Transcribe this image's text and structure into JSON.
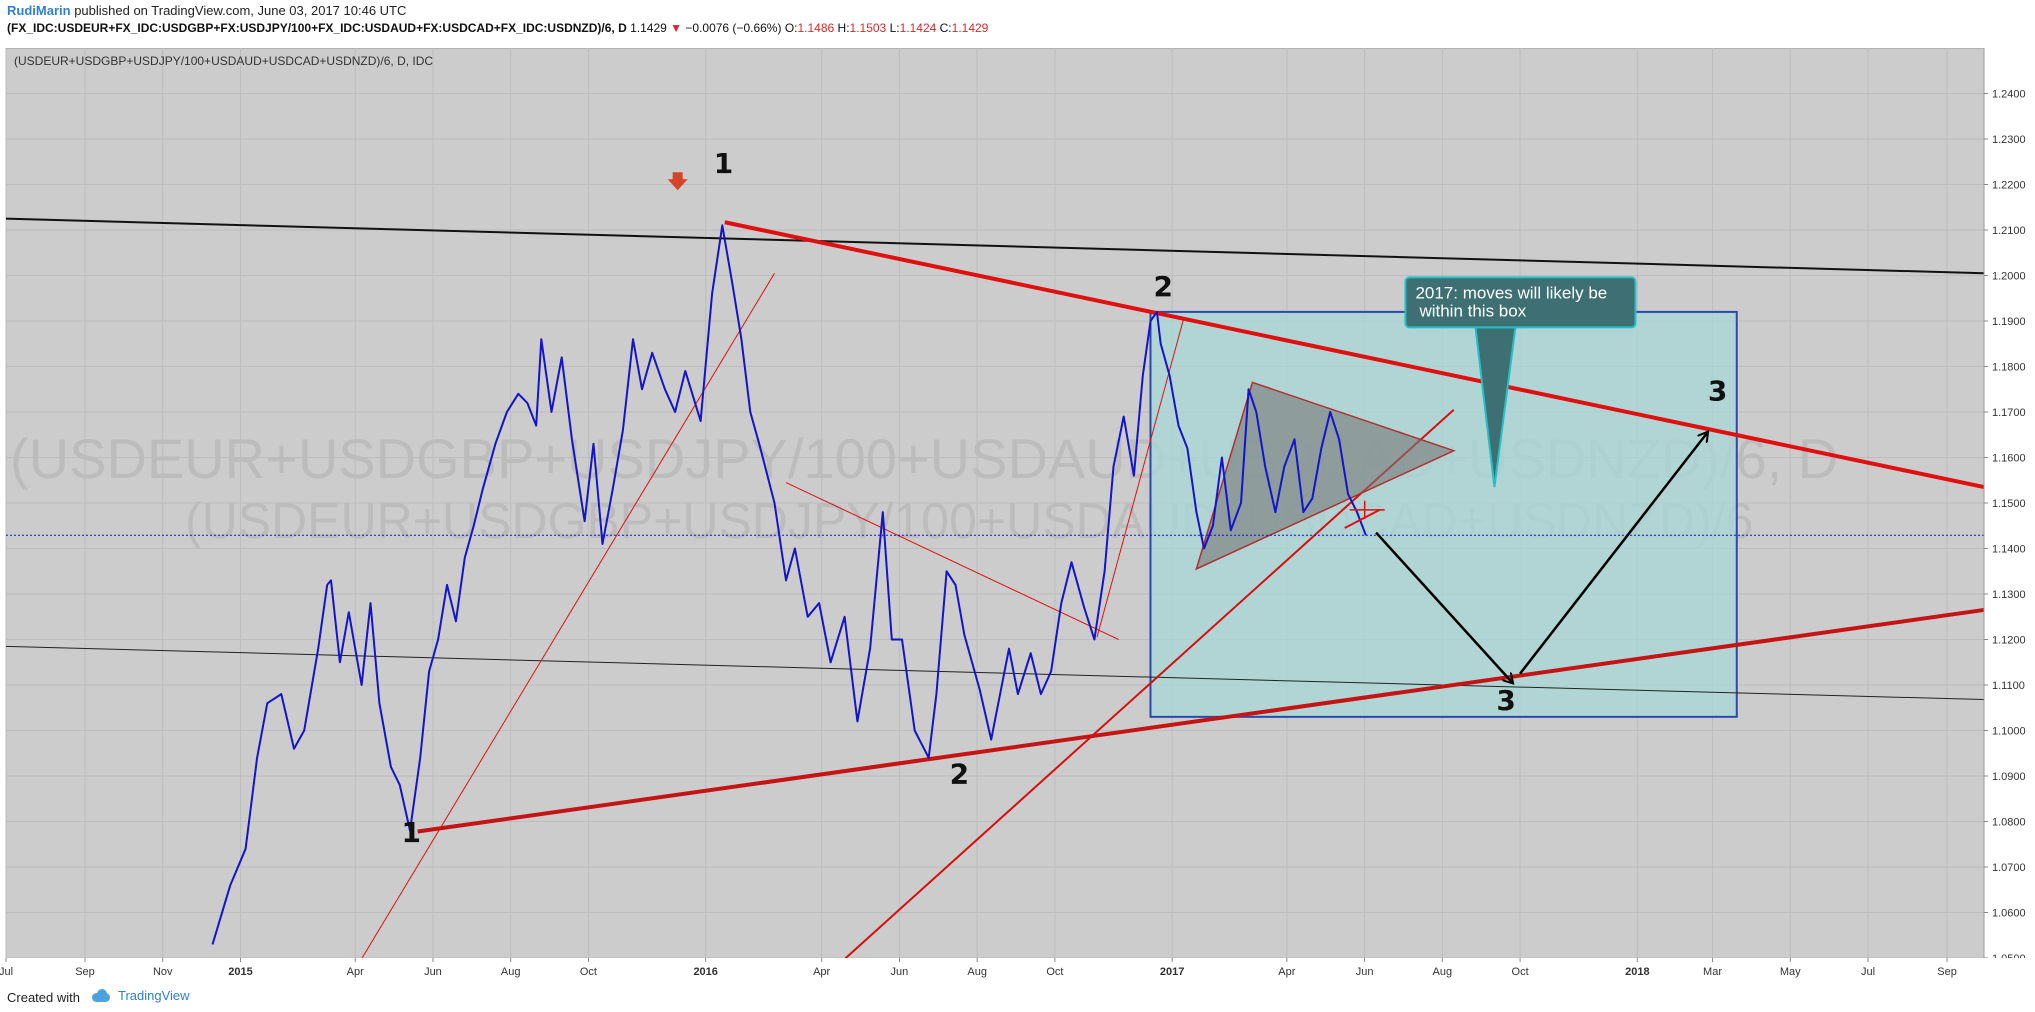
{
  "header": {
    "author": "RudiMarin",
    "published": "published on TradingView.com, June 03, 2017 10:46 UTC",
    "symbol": "(FX_IDC:USDEUR+FX_IDC:USDGBP+FX:USDJPY/100+FX_IDC:USDAUD+FX:USDCAD+FX_IDC:USDNZD)/6, D",
    "last": "1.1429",
    "change": "−0.0076 (−0.66%)",
    "o_label": "O:",
    "o": "1.1486",
    "h_label": "H:",
    "h": "1.1503",
    "l_label": "L:",
    "l": "1.1424",
    "c_label": "C:",
    "c": "1.1429"
  },
  "legend": "(USDEUR+USDGBP+USDJPY/100+USDAUD+USDCAD+USDNZD)/6, D, IDC",
  "watermark": {
    "line1": "(USDEUR+USDGBP+USDJPY/100+USDAUD+USDCAD+USDNZD)/6, D",
    "line2": "(USDEUR+USDGBP+USDJPY/100+USDAUD+USDCAD+USDNZD)/6"
  },
  "footer": {
    "created": "Created with",
    "brand": "TradingView"
  },
  "colors": {
    "plot_bg": "#cccccc",
    "price_line": "#1414c8",
    "trend_red": "#e01010",
    "box_fill": "#a8d8d8",
    "box_border": "#2a4aa8",
    "callout_bg": "#3e6f73",
    "callout_border": "#24c0c8",
    "last_price_bg": "#1414c8"
  },
  "chart_data": {
    "type": "line",
    "series": [
      {
        "values": [
          {
            "x": "2014-12-10",
            "y": 1.053
          },
          {
            "x": "2014-12-24",
            "y": 1.066
          },
          {
            "x": "2015-01-05",
            "y": 1.074
          },
          {
            "x": "2015-01-14",
            "y": 1.094
          },
          {
            "x": "2015-01-22",
            "y": 1.106
          },
          {
            "x": "2015-02-02",
            "y": 1.108
          },
          {
            "x": "2015-02-12",
            "y": 1.096
          },
          {
            "x": "2015-02-20",
            "y": 1.1
          },
          {
            "x": "2015-03-03",
            "y": 1.118
          },
          {
            "x": "2015-03-10",
            "y": 1.132
          },
          {
            "x": "2015-03-13",
            "y": 1.133
          },
          {
            "x": "2015-03-20",
            "y": 1.115
          },
          {
            "x": "2015-03-27",
            "y": 1.126
          },
          {
            "x": "2015-04-06",
            "y": 1.11
          },
          {
            "x": "2015-04-13",
            "y": 1.128
          },
          {
            "x": "2015-04-20",
            "y": 1.106
          },
          {
            "x": "2015-04-29",
            "y": 1.092
          },
          {
            "x": "2015-05-06",
            "y": 1.088
          },
          {
            "x": "2015-05-14",
            "y": 1.078
          },
          {
            "x": "2015-05-22",
            "y": 1.094
          },
          {
            "x": "2015-05-29",
            "y": 1.113
          },
          {
            "x": "2015-06-05",
            "y": 1.12
          },
          {
            "x": "2015-06-12",
            "y": 1.132
          },
          {
            "x": "2015-06-19",
            "y": 1.124
          },
          {
            "x": "2015-06-26",
            "y": 1.138
          },
          {
            "x": "2015-07-03",
            "y": 1.145
          },
          {
            "x": "2015-07-10",
            "y": 1.153
          },
          {
            "x": "2015-07-20",
            "y": 1.163
          },
          {
            "x": "2015-07-29",
            "y": 1.17
          },
          {
            "x": "2015-08-07",
            "y": 1.174
          },
          {
            "x": "2015-08-14",
            "y": 1.172
          },
          {
            "x": "2015-08-21",
            "y": 1.167
          },
          {
            "x": "2015-08-25",
            "y": 1.186
          },
          {
            "x": "2015-09-02",
            "y": 1.17
          },
          {
            "x": "2015-09-10",
            "y": 1.182
          },
          {
            "x": "2015-09-18",
            "y": 1.164
          },
          {
            "x": "2015-09-28",
            "y": 1.146
          },
          {
            "x": "2015-10-05",
            "y": 1.163
          },
          {
            "x": "2015-10-12",
            "y": 1.141
          },
          {
            "x": "2015-10-20",
            "y": 1.153
          },
          {
            "x": "2015-10-28",
            "y": 1.166
          },
          {
            "x": "2015-11-05",
            "y": 1.186
          },
          {
            "x": "2015-11-12",
            "y": 1.175
          },
          {
            "x": "2015-11-20",
            "y": 1.183
          },
          {
            "x": "2015-11-30",
            "y": 1.175
          },
          {
            "x": "2015-12-08",
            "y": 1.17
          },
          {
            "x": "2015-12-16",
            "y": 1.179
          },
          {
            "x": "2015-12-28",
            "y": 1.168
          },
          {
            "x": "2016-01-06",
            "y": 1.196
          },
          {
            "x": "2016-01-14",
            "y": 1.211
          },
          {
            "x": "2016-01-22",
            "y": 1.198
          },
          {
            "x": "2016-01-29",
            "y": 1.186
          },
          {
            "x": "2016-02-05",
            "y": 1.17
          },
          {
            "x": "2016-02-12",
            "y": 1.163
          },
          {
            "x": "2016-02-24",
            "y": 1.15
          },
          {
            "x": "2016-03-04",
            "y": 1.133
          },
          {
            "x": "2016-03-11",
            "y": 1.14
          },
          {
            "x": "2016-03-21",
            "y": 1.125
          },
          {
            "x": "2016-03-30",
            "y": 1.128
          },
          {
            "x": "2016-04-08",
            "y": 1.115
          },
          {
            "x": "2016-04-19",
            "y": 1.125
          },
          {
            "x": "2016-04-29",
            "y": 1.102
          },
          {
            "x": "2016-05-09",
            "y": 1.118
          },
          {
            "x": "2016-05-19",
            "y": 1.148
          },
          {
            "x": "2016-05-26",
            "y": 1.12
          },
          {
            "x": "2016-06-03",
            "y": 1.12
          },
          {
            "x": "2016-06-13",
            "y": 1.1
          },
          {
            "x": "2016-06-24",
            "y": 1.094
          },
          {
            "x": "2016-06-30",
            "y": 1.108
          },
          {
            "x": "2016-07-08",
            "y": 1.135
          },
          {
            "x": "2016-07-15",
            "y": 1.132
          },
          {
            "x": "2016-07-22",
            "y": 1.121
          },
          {
            "x": "2016-08-03",
            "y": 1.109
          },
          {
            "x": "2016-08-12",
            "y": 1.098
          },
          {
            "x": "2016-08-19",
            "y": 1.108
          },
          {
            "x": "2016-08-26",
            "y": 1.118
          },
          {
            "x": "2016-09-02",
            "y": 1.108
          },
          {
            "x": "2016-09-12",
            "y": 1.117
          },
          {
            "x": "2016-09-20",
            "y": 1.108
          },
          {
            "x": "2016-09-28",
            "y": 1.113
          },
          {
            "x": "2016-10-06",
            "y": 1.128
          },
          {
            "x": "2016-10-14",
            "y": 1.137
          },
          {
            "x": "2016-10-24",
            "y": 1.127
          },
          {
            "x": "2016-11-01",
            "y": 1.12
          },
          {
            "x": "2016-11-09",
            "y": 1.135
          },
          {
            "x": "2016-11-16",
            "y": 1.158
          },
          {
            "x": "2016-11-24",
            "y": 1.169
          },
          {
            "x": "2016-12-02",
            "y": 1.156
          },
          {
            "x": "2016-12-09",
            "y": 1.178
          },
          {
            "x": "2016-12-15",
            "y": 1.19
          },
          {
            "x": "2016-12-20",
            "y": 1.192
          },
          {
            "x": "2016-12-23",
            "y": 1.185
          },
          {
            "x": "2016-12-30",
            "y": 1.178
          },
          {
            "x": "2017-01-06",
            "y": 1.167
          },
          {
            "x": "2017-01-13",
            "y": 1.162
          },
          {
            "x": "2017-01-20",
            "y": 1.148
          },
          {
            "x": "2017-01-26",
            "y": 1.14
          },
          {
            "x": "2017-02-02",
            "y": 1.145
          },
          {
            "x": "2017-02-09",
            "y": 1.16
          },
          {
            "x": "2017-02-16",
            "y": 1.144
          },
          {
            "x": "2017-02-24",
            "y": 1.15
          },
          {
            "x": "2017-03-02",
            "y": 1.175
          },
          {
            "x": "2017-03-08",
            "y": 1.17
          },
          {
            "x": "2017-03-15",
            "y": 1.158
          },
          {
            "x": "2017-03-23",
            "y": 1.148
          },
          {
            "x": "2017-03-30",
            "y": 1.158
          },
          {
            "x": "2017-04-07",
            "y": 1.164
          },
          {
            "x": "2017-04-14",
            "y": 1.148
          },
          {
            "x": "2017-04-21",
            "y": 1.151
          },
          {
            "x": "2017-04-28",
            "y": 1.162
          },
          {
            "x": "2017-05-05",
            "y": 1.17
          },
          {
            "x": "2017-05-12",
            "y": 1.164
          },
          {
            "x": "2017-05-19",
            "y": 1.152
          },
          {
            "x": "2017-05-26",
            "y": 1.148
          },
          {
            "x": "2017-06-02",
            "y": 1.1429
          }
        ]
      }
    ],
    "ylim": [
      1.05,
      1.25
    ],
    "xlim": [
      "2014-07-01",
      "2018-09-30"
    ],
    "y_ticks": [
      "1.2400",
      "1.2300",
      "1.2200",
      "1.2100",
      "1.2000",
      "1.1900",
      "1.1800",
      "1.1700",
      "1.1600",
      "1.1500",
      "1.1400",
      "1.1300",
      "1.1200",
      "1.1100",
      "1.1000",
      "1.0900",
      "1.0800",
      "1.0700",
      "1.0600",
      "1.0500"
    ],
    "x_ticks": [
      {
        "label": "Jul",
        "date": "2014-07-01"
      },
      {
        "label": "Sep",
        "date": "2014-09-01"
      },
      {
        "label": "Nov",
        "date": "2014-11-01"
      },
      {
        "label": "2015",
        "date": "2015-01-01"
      },
      {
        "label": "Apr",
        "date": "2015-04-01"
      },
      {
        "label": "Jun",
        "date": "2015-06-01"
      },
      {
        "label": "Aug",
        "date": "2015-08-01"
      },
      {
        "label": "Oct",
        "date": "2015-10-01"
      },
      {
        "label": "2016",
        "date": "2016-01-01"
      },
      {
        "label": "Apr",
        "date": "2016-04-01"
      },
      {
        "label": "Jun",
        "date": "2016-06-01"
      },
      {
        "label": "Aug",
        "date": "2016-08-01"
      },
      {
        "label": "Oct",
        "date": "2016-10-01"
      },
      {
        "label": "2017",
        "date": "2017-01-01"
      },
      {
        "label": "Apr",
        "date": "2017-04-01"
      },
      {
        "label": "Jun",
        "date": "2017-06-01"
      },
      {
        "label": "Aug",
        "date": "2017-08-01"
      },
      {
        "label": "Oct",
        "date": "2017-10-01"
      },
      {
        "label": "2018",
        "date": "2018-01-01"
      },
      {
        "label": "Mar",
        "date": "2018-03-01"
      },
      {
        "label": "May",
        "date": "2018-05-01"
      },
      {
        "label": "Jul",
        "date": "2018-07-01"
      },
      {
        "label": "Sep",
        "date": "2018-09-01"
      }
    ],
    "last_price_label": "1.1429",
    "last_price": 1.1429,
    "grid": true,
    "annotations": {
      "labels": [
        {
          "text": "1",
          "x": "2016-01-15",
          "y": 1.2225
        },
        {
          "text": "1",
          "x": "2015-05-15",
          "y": 1.0755
        },
        {
          "text": "2",
          "x": "2016-12-25",
          "y": 1.1955
        },
        {
          "text": "2",
          "x": "2016-07-18",
          "y": 1.0883
        },
        {
          "text": "3",
          "x": "2018-03-05",
          "y": 1.1725
        },
        {
          "text": "3",
          "x": "2017-09-20",
          "y": 1.1045
        }
      ],
      "callout": {
        "text": "2017: moves will likely be within this box",
        "x": "2017-09-25",
        "y": 1.1965
      },
      "lines": [
        {
          "name": "black-top-channel-line",
          "x1": "2014-07-01",
          "y1": 1.2125,
          "x2": "2018-09-30",
          "y2": 1.2005
        },
        {
          "name": "black-bottom-channel-line",
          "x1": "2014-07-01",
          "y1": 1.1185,
          "x2": "2018-09-30",
          "y2": 1.1068
        },
        {
          "name": "red-thick-resistance-line",
          "x1": "2016-01-16",
          "y1": 1.2117,
          "x2": "2018-09-30",
          "y2": 1.1535
        },
        {
          "name": "red-thick-support-line",
          "x1": "2015-05-20",
          "y1": 1.0778,
          "x2": "2018-09-30",
          "y2": 1.1265
        },
        {
          "name": "red-thin-rising-line-a",
          "x1": "2015-04-01",
          "y1": 1.0475,
          "x2": "2016-02-24",
          "y2": 1.2005
        },
        {
          "name": "red-thin-falling-line",
          "x1": "2016-03-04",
          "y1": 1.1545,
          "x2": "2016-11-20",
          "y2": 1.12
        },
        {
          "name": "red-thin-rising-line-b",
          "x1": "2016-11-03",
          "y1": 1.1205,
          "x2": "2017-01-10",
          "y2": 1.1905
        },
        {
          "name": "red-medium-rising-line",
          "x1": "2016-04-10",
          "y1": 1.0475,
          "x2": "2017-08-10",
          "y2": 1.1705
        }
      ],
      "box": {
        "x1": "2016-12-15",
        "y1": 1.192,
        "x2": "2018-03-20",
        "y2": 1.103
      },
      "triangle": [
        {
          "x": "2017-01-20",
          "y": 1.1355
        },
        {
          "x": "2017-03-05",
          "y": 1.1765
        },
        {
          "x": "2017-08-10",
          "y": 1.1615
        }
      ],
      "arrows": [
        {
          "name": "down-arrow",
          "x1": "2017-06-10",
          "y1": 1.1435,
          "x2": "2017-09-25",
          "y2": 1.1105
        },
        {
          "name": "up-arrow",
          "x1": "2017-10-01",
          "y1": 1.1125,
          "x2": "2018-02-25",
          "y2": 1.1655
        }
      ]
    }
  }
}
